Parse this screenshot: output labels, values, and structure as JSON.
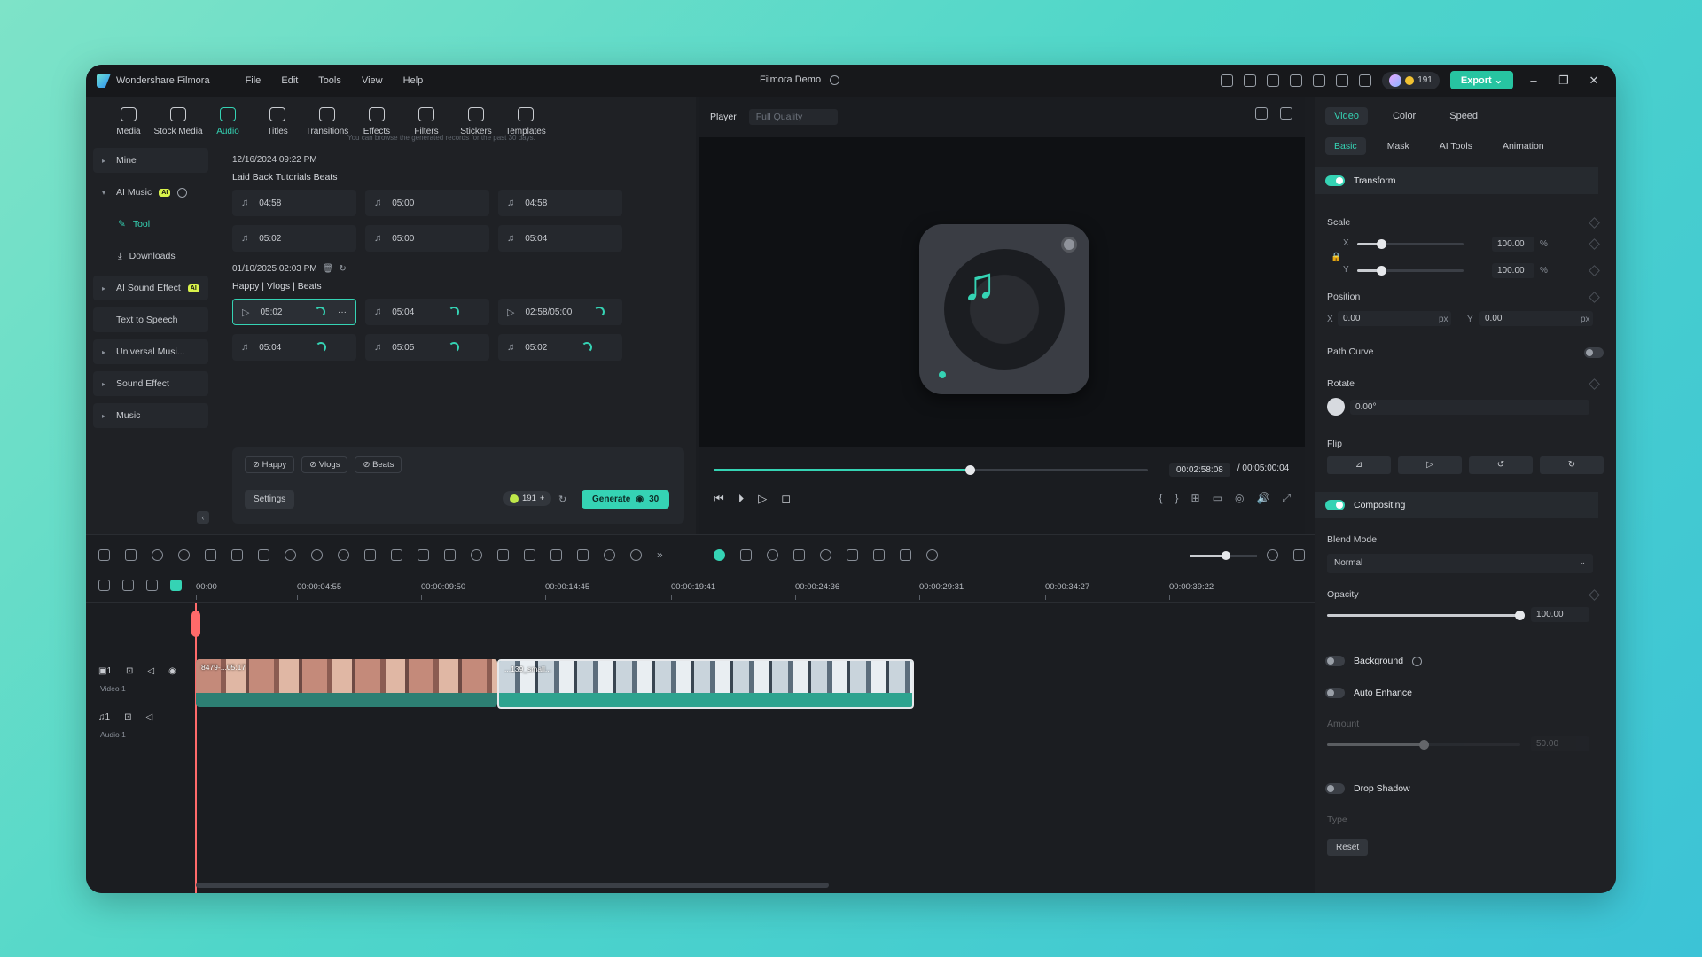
{
  "app": {
    "name": "Wondershare Filmora",
    "menu": [
      "File",
      "Edit",
      "Tools",
      "View",
      "Help"
    ],
    "doc_title": "Filmora Demo",
    "credits": "191",
    "export_label": "Export"
  },
  "media_toolbar": [
    {
      "label": "Media",
      "icon": "media-icon"
    },
    {
      "label": "Stock Media",
      "icon": "stock-media-icon"
    },
    {
      "label": "Audio",
      "icon": "audio-icon",
      "active": true
    },
    {
      "label": "Titles",
      "icon": "titles-icon"
    },
    {
      "label": "Transitions",
      "icon": "transitions-icon"
    },
    {
      "label": "Effects",
      "icon": "effects-icon"
    },
    {
      "label": "Filters",
      "icon": "filters-icon"
    },
    {
      "label": "Stickers",
      "icon": "stickers-icon"
    },
    {
      "label": "Templates",
      "icon": "templates-icon"
    }
  ],
  "sidebar": {
    "items": [
      {
        "label": "Mine"
      },
      {
        "label": "AI Music",
        "badge": "AI"
      },
      {
        "label": "Tool"
      },
      {
        "label": "Downloads"
      },
      {
        "label": "AI Sound Effect",
        "badge": "AI"
      },
      {
        "label": "Text to Speech"
      },
      {
        "label": "Universal Musi..."
      },
      {
        "label": "Sound Effect"
      },
      {
        "label": "Music"
      }
    ]
  },
  "records": {
    "note": "You can browse the generated records for the past 30 days.",
    "groups": [
      {
        "date": "12/16/2024 09:22 PM",
        "title": "Laid Back Tutorials Beats",
        "clips": [
          "04:58",
          "05:00",
          "04:58",
          "05:02",
          "05:00",
          "05:04"
        ]
      },
      {
        "date": "01/10/2025 02:03 PM",
        "title": "Happy | Vlogs | Beats",
        "clips": [
          "05:02",
          "05:04",
          "02:58/05:00",
          "05:04",
          "05:05",
          "05:02"
        ]
      }
    ]
  },
  "generate": {
    "tags": [
      "Happy",
      "Vlogs",
      "Beats"
    ],
    "settings_label": "Settings",
    "credits": "191",
    "button_label": "Generate",
    "cost": "30"
  },
  "player": {
    "label": "Player",
    "quality": "Full Quality",
    "current_time": "00:02:58:08",
    "total_time": "/ 00:05:00:04",
    "progress": 0.59
  },
  "properties": {
    "tabs": [
      "Video",
      "Color",
      "Speed"
    ],
    "subtabs": [
      "Basic",
      "Mask",
      "AI Tools",
      "Animation"
    ],
    "transform": "Transform",
    "scale_label": "Scale",
    "scale_x": "100.00",
    "scale_y": "100.00",
    "position_label": "Position",
    "pos_x": "0.00",
    "pos_y": "0.00",
    "path_curve": "Path Curve",
    "rotate_label": "Rotate",
    "rotate_value": "0.00°",
    "flip_label": "Flip",
    "compositing": "Compositing",
    "blend_label": "Blend Mode",
    "blend_value": "Normal",
    "opacity_label": "Opacity",
    "opacity_value": "100.00",
    "background": "Background",
    "auto_enhance": "Auto Enhance",
    "amount_label": "Amount",
    "amount_value": "50.00",
    "drop_shadow": "Drop Shadow",
    "type_label": "Type",
    "reset_label": "Reset",
    "unit_pct": "%",
    "unit_px": "px",
    "x": "X",
    "y": "Y"
  },
  "timeline": {
    "ticks": [
      "00:00",
      "00:00:04:55",
      "00:00:09:50",
      "00:00:14:45",
      "00:00:19:41",
      "00:00:24:36",
      "00:00:29:31",
      "00:00:34:27",
      "00:00:39:22"
    ],
    "tracks": [
      {
        "name": "Video 1",
        "num": "1"
      },
      {
        "name": "Audio 1",
        "num": "1"
      }
    ],
    "clips": [
      "8479-...05:17",
      "...139_small..."
    ]
  }
}
